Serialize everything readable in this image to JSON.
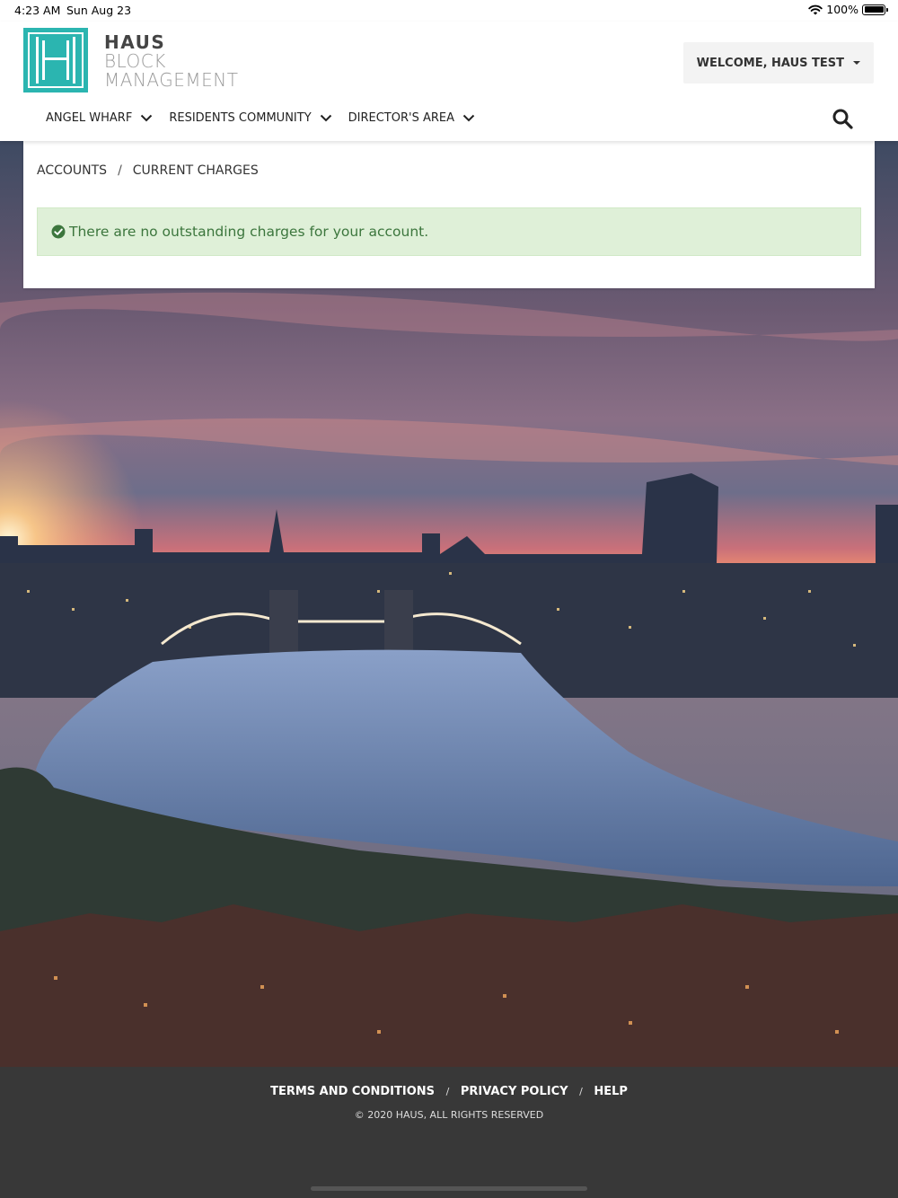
{
  "status_bar": {
    "time": "4:23 AM",
    "date": "Sun Aug 23",
    "battery": "100%"
  },
  "logo": {
    "line1": "HAUS",
    "line2": "BLOCK",
    "line3": "MANAGEMENT"
  },
  "user_menu": {
    "label": "WELCOME, HAUS TEST"
  },
  "nav": {
    "items": [
      {
        "label": "ANGEL WHARF"
      },
      {
        "label": "RESIDENTS COMMUNITY"
      },
      {
        "label": "DIRECTOR'S AREA"
      }
    ]
  },
  "breadcrumb": {
    "items": [
      "ACCOUNTS",
      "CURRENT CHARGES"
    ],
    "separator": "/"
  },
  "alert": {
    "message": "There are no outstanding charges for your account."
  },
  "footer": {
    "links": [
      "TERMS AND CONDITIONS",
      "PRIVACY POLICY",
      "HELP"
    ],
    "separator": "/",
    "copyright": "© 2020 HAUS, ALL RIGHTS RESERVED"
  },
  "colors": {
    "brand_teal": "#2bb5b0",
    "alert_bg": "#dff0d8",
    "alert_text": "#3c763d",
    "footer_bg": "#383838"
  },
  "icons": [
    "wifi-icon",
    "battery-icon",
    "haus-logo-icon",
    "chevron-down-icon",
    "search-icon",
    "check-circle-icon"
  ]
}
